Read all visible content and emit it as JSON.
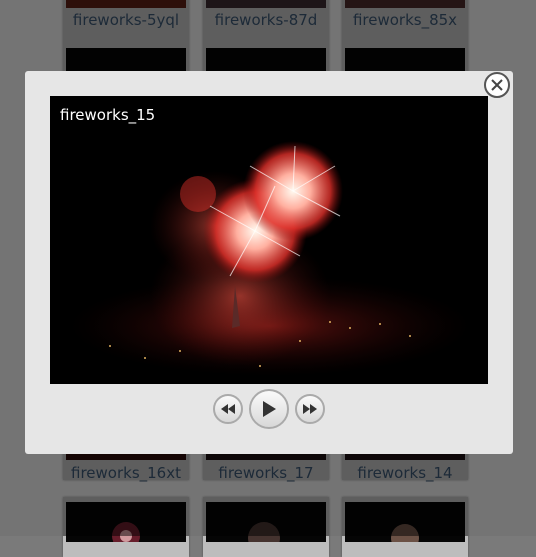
{
  "gallery": {
    "captions": {
      "r1c1": "fireworks-5yql",
      "r1c2": "fireworks-87d",
      "r1c3": "fireworks_85x",
      "r3c1": "fireworks_16xt",
      "r3c2": "fireworks_17",
      "r3c3": "fireworks_14"
    }
  },
  "lightbox": {
    "title": "fireworks_15",
    "icons": {
      "close": "close-icon",
      "prev": "previous-icon",
      "play": "play-icon",
      "next": "next-icon"
    }
  },
  "colors": {
    "caption_text": "#3a5570",
    "firework_red": "#e8403a",
    "firework_white": "#fff4ea"
  }
}
